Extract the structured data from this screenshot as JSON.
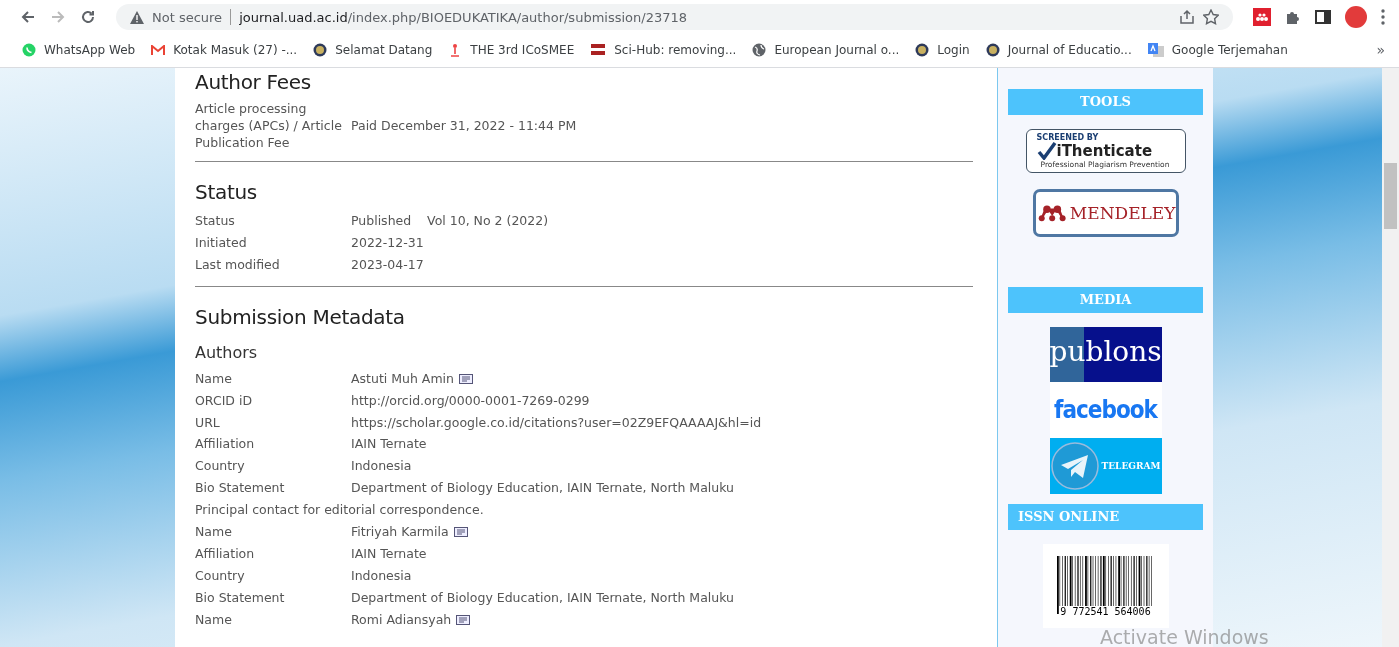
{
  "browser": {
    "security": "Not secure",
    "url_host": "journal.uad.ac.id",
    "url_path": "/index.php/BIOEDUKATIKA/author/submission/23718",
    "bookmarks": [
      {
        "label": "WhatsApp Web",
        "kind": "whatsapp"
      },
      {
        "label": "Kotak Masuk (27) -...",
        "kind": "gmail"
      },
      {
        "label": "Selamat Datang",
        "kind": "seal"
      },
      {
        "label": "THE 3rd ICoSMEE",
        "kind": "figure"
      },
      {
        "label": "Sci-Hub: removing...",
        "kind": "scihub"
      },
      {
        "label": "European Journal o...",
        "kind": "globe"
      },
      {
        "label": "Login",
        "kind": "seal"
      },
      {
        "label": "Journal of Educatio...",
        "kind": "seal"
      },
      {
        "label": "Google Terjemahan",
        "kind": "translate"
      }
    ],
    "overflow": "»"
  },
  "fees": {
    "heading": "Author Fees",
    "rows": [
      {
        "label": "Article processing charges (APCs) / Article Publication Fee",
        "value": "Paid December 31, 2022 - 11:44 PM"
      }
    ]
  },
  "status": {
    "heading": "Status",
    "rows": [
      {
        "label": "Status",
        "value": "Published    Vol 10, No 2 (2022)"
      },
      {
        "label": "Initiated",
        "value": "2022-12-31"
      },
      {
        "label": "Last modified",
        "value": "2023-04-17"
      }
    ]
  },
  "metadata": {
    "heading": "Submission Metadata",
    "subheading": "Authors",
    "authors": [
      {
        "rows": [
          {
            "label": "Name",
            "value": "Astuti Muh Amin",
            "mail": true
          },
          {
            "label": "ORCID iD",
            "value": "http://orcid.org/0000-0001-7269-0299"
          },
          {
            "label": "URL",
            "value": "https://scholar.google.co.id/citations?user=02Z9EFQAAAAJ&hl=id"
          },
          {
            "label": "Affiliation",
            "value": "IAIN Ternate"
          },
          {
            "label": "Country",
            "value": "Indonesia"
          },
          {
            "label": "Bio Statement",
            "value": "Department of Biology Education, IAIN Ternate, North Maluku"
          }
        ],
        "note": "Principal contact for editorial correspondence."
      },
      {
        "rows": [
          {
            "label": "Name",
            "value": "Fitriyah Karmila",
            "mail": true
          },
          {
            "label": "Affiliation",
            "value": "IAIN Ternate"
          },
          {
            "label": "Country",
            "value": "Indonesia"
          },
          {
            "label": "Bio Statement",
            "value": "Department of Biology Education, IAIN Ternate, North Maluku"
          }
        ]
      },
      {
        "rows": [
          {
            "label": "Name",
            "value": "Romi Adiansyah",
            "mail": true
          }
        ]
      }
    ]
  },
  "sidebar": [
    {
      "title": "TOOLS",
      "items": [
        {
          "kind": "ithenticate",
          "top": "SCREENED BY",
          "main": "iThenticate",
          "sub": "Professional Plagiarism Prevention"
        },
        {
          "kind": "mendeley",
          "main": "MENDELEY"
        }
      ]
    },
    {
      "title": "MEDIA",
      "items": [
        {
          "kind": "publons",
          "main": "publons"
        },
        {
          "kind": "facebook",
          "main": "facebook"
        },
        {
          "kind": "telegram",
          "main": "TELEGRAM"
        }
      ]
    },
    {
      "title": "ISSN ONLINE",
      "items": [
        {
          "kind": "barcode",
          "main": "9 772541 564006"
        }
      ]
    }
  ],
  "os_notice": "Activate Windows"
}
